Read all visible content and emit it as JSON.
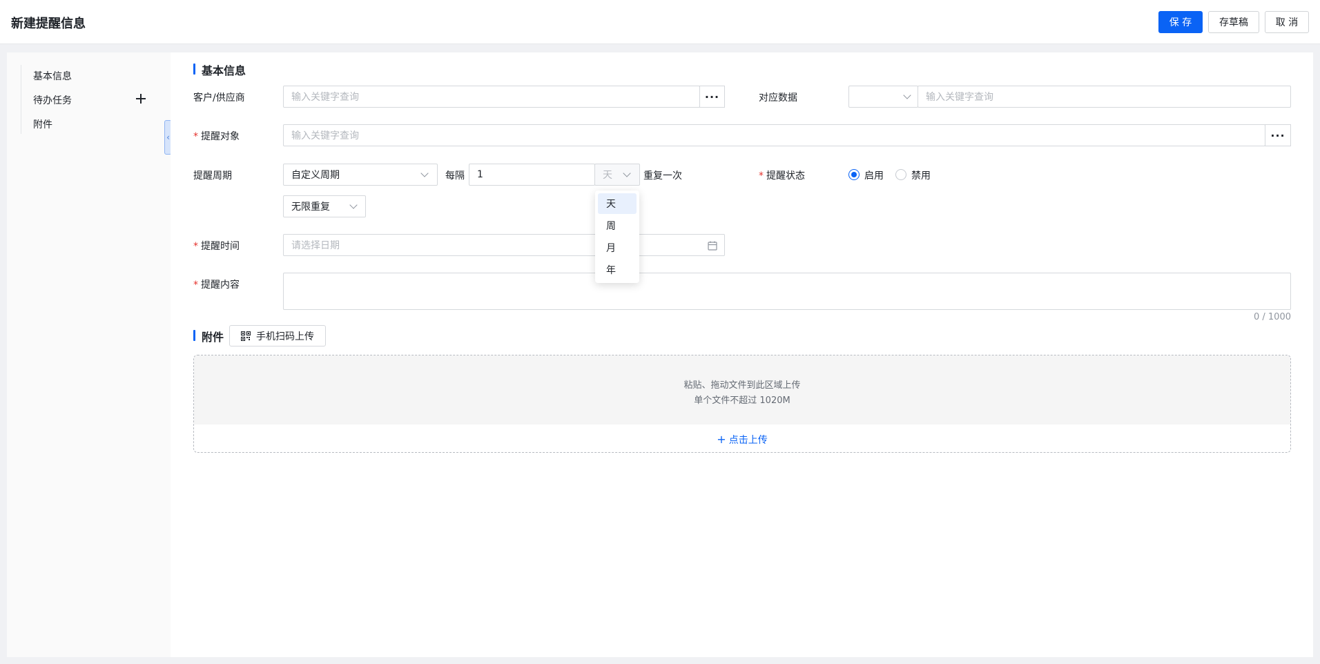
{
  "header": {
    "title": "新建提醒信息",
    "save_label": "保 存",
    "draft_label": "存草稿",
    "cancel_label": "取 消"
  },
  "sidebar": {
    "items": [
      {
        "label": "基本信息"
      },
      {
        "label": "待办任务"
      },
      {
        "label": "附件"
      }
    ]
  },
  "colors": {
    "primary": "#0a63f5",
    "required": "#e5322d"
  },
  "basic_section": {
    "title": "基本信息",
    "customer": {
      "label": "客户/供应商",
      "placeholder": "输入关键字查询"
    },
    "related": {
      "label": "对应数据",
      "select_value": "",
      "placeholder": "输入关键字查询"
    },
    "target": {
      "label": "提醒对象",
      "placeholder": "输入关键字查询"
    },
    "cycle": {
      "label": "提醒周期",
      "type_value": "自定义周期",
      "every_label": "每隔",
      "interval_value": "1",
      "unit_value": "天",
      "repeat_label": "重复一次",
      "repeat_mode_value": "无限重复",
      "unit_options": [
        "天",
        "周",
        "月",
        "年"
      ],
      "selected_unit": "天"
    },
    "status": {
      "label": "提醒状态",
      "options": [
        "启用",
        "禁用"
      ],
      "selected": "启用"
    },
    "time": {
      "label": "提醒时间",
      "placeholder": "请选择日期"
    },
    "content": {
      "label": "提醒内容",
      "value": "",
      "counter": "0 / 1000"
    }
  },
  "attachment_section": {
    "title": "附件",
    "qr_button_label": "手机扫码上传",
    "drop_hint": "粘贴、拖动文件到此区域上传",
    "size_hint": "单个文件不超过 1020M",
    "upload_link_label": "点击上传"
  },
  "icons": {
    "more": "more-dots-icon",
    "calendar": "calendar-icon",
    "qr": "qr-code-icon",
    "plus": "plus-icon",
    "chevron": "chevron-down-icon",
    "collapse": "collapse-left-icon"
  }
}
